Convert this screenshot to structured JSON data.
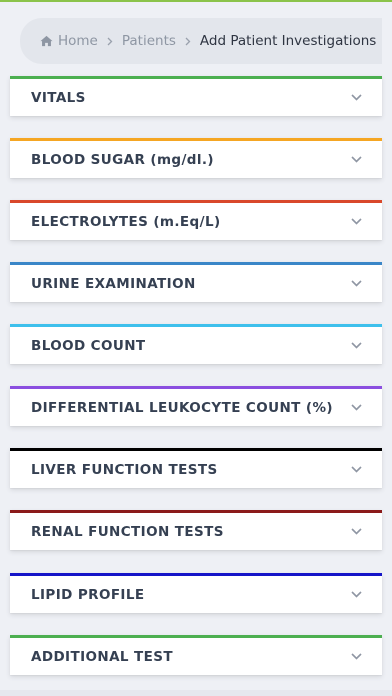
{
  "breadcrumb": {
    "home": "Home",
    "patients": "Patients",
    "current": "Add Patient Investigations"
  },
  "icons": {
    "home": "home-icon",
    "separator": "chevron-right-icon",
    "expand": "chevron-down-icon"
  },
  "colors": {
    "vitals": "#4caf50",
    "blood_sugar": "#f5a623",
    "electrolytes": "#d9482b",
    "urine": "#3a86c8",
    "blood_count": "#3ec0ec",
    "differential": "#8b4fe0",
    "liver": "#000000",
    "renal": "#8b1a1a",
    "lipid": "#1515c8",
    "additional": "#4caf50"
  },
  "sections": [
    {
      "label": "VITALS"
    },
    {
      "label": "BLOOD SUGAR (mg/dl.)"
    },
    {
      "label": "ELECTROLYTES (m.Eq/L)"
    },
    {
      "label": "URINE EXAMINATION"
    },
    {
      "label": "BLOOD COUNT"
    },
    {
      "label": "DIFFERENTIAL LEUKOCYTE COUNT (%)"
    },
    {
      "label": "LIVER FUNCTION TESTS"
    },
    {
      "label": "RENAL FUNCTION TESTS"
    },
    {
      "label": "LIPID PROFILE"
    },
    {
      "label": "ADDITIONAL TEST"
    }
  ]
}
